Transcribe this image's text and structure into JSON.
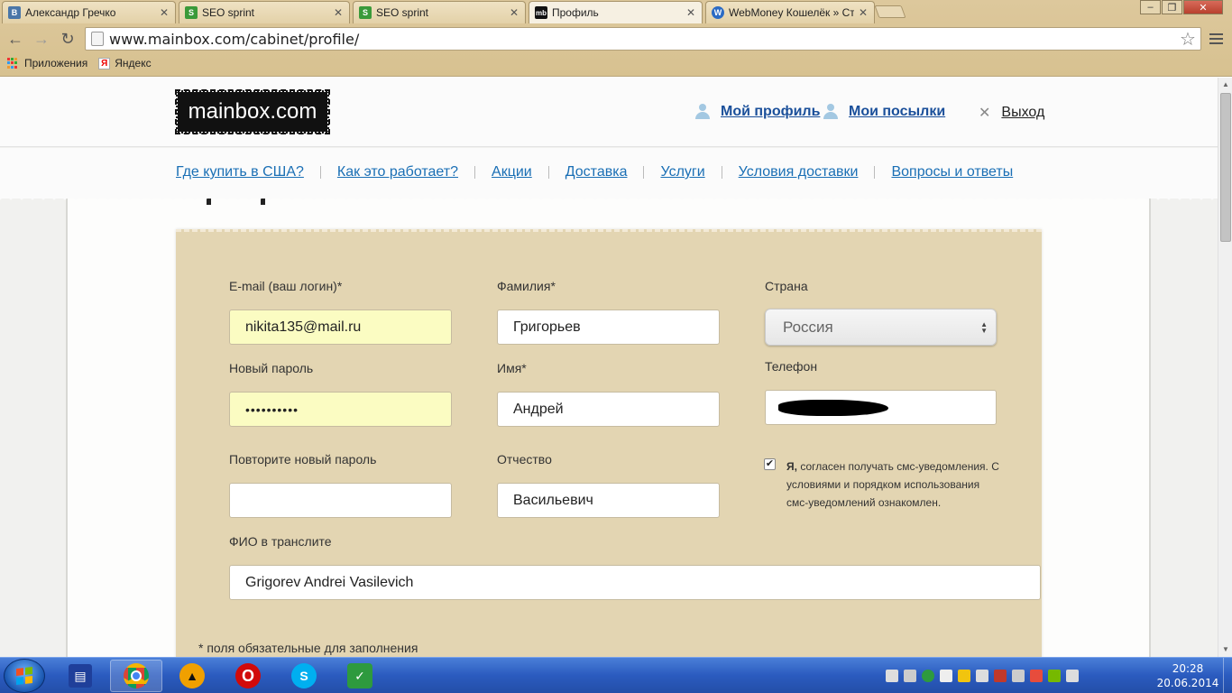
{
  "browser": {
    "tabs": [
      {
        "title": "Александр Гречко",
        "favicon": "vk-icon",
        "favicon_color": "#4a76a8",
        "favicon_text": "В"
      },
      {
        "title": "SEO sprint",
        "favicon": "seosprint-icon",
        "favicon_color": "#3a9a3a",
        "favicon_text": "S"
      },
      {
        "title": "SEO sprint",
        "favicon": "seosprint-icon",
        "favicon_color": "#3a9a3a",
        "favicon_text": "S"
      },
      {
        "title": "Профиль",
        "favicon": "mainbox-icon",
        "favicon_color": "#111111",
        "favicon_text": "mb"
      },
      {
        "title": "WebMoney Кошелёк » Ст",
        "favicon": "webmoney-icon",
        "favicon_color": "#2b6bc4",
        "favicon_text": "W"
      }
    ],
    "active_tab_index": 3,
    "window_controls": {
      "minimize": "–",
      "maximize": "❐",
      "close": "✕"
    },
    "address": "www.mainbox.com/cabinet/profile/",
    "bookmarks": [
      "Приложения",
      "Яндекс"
    ]
  },
  "site": {
    "logo": "mainbox.com",
    "header_links": {
      "profile": "Мой профиль",
      "parcels": "Мои посылки",
      "logout": "Выход"
    },
    "nav": [
      "Где купить в США?",
      "Как это работает?",
      "Акции",
      "Доставка",
      "Услуги",
      "Условия доставки",
      "Вопросы и ответы"
    ]
  },
  "form": {
    "email": {
      "label": "E-mail (ваш логин)*",
      "value": "nikita135@mail.ru"
    },
    "new_password": {
      "label": "Новый пароль",
      "value": "••••••••••"
    },
    "repeat_password": {
      "label": "Повторите новый пароль",
      "value": ""
    },
    "translit": {
      "label": "ФИО в транслите",
      "value": "Grigorev Andrei Vasilevich"
    },
    "last_name": {
      "label": "Фамилия*",
      "value": "Григорьев"
    },
    "first_name": {
      "label": "Имя*",
      "value": "Андрей"
    },
    "patronymic": {
      "label": "Отчество",
      "value": "Васильевич"
    },
    "country": {
      "label": "Страна",
      "value": "Россия"
    },
    "phone": {
      "label": "Телефон",
      "value": ""
    },
    "sms_consent": {
      "checked": true,
      "bold_part": "Я,",
      "text": "согласен получать смс-уведомления. С условиями и порядком использования смс-уведомлений ознакомлен."
    },
    "required_note": "* поля обязательные для заполнения"
  },
  "taskbar": {
    "apps": [
      "save-icon",
      "chrome-icon",
      "avast-icon",
      "opera-icon",
      "skype-icon",
      "adguard-icon"
    ],
    "clock_time": "20:28",
    "clock_date": "20.06.2014"
  }
}
